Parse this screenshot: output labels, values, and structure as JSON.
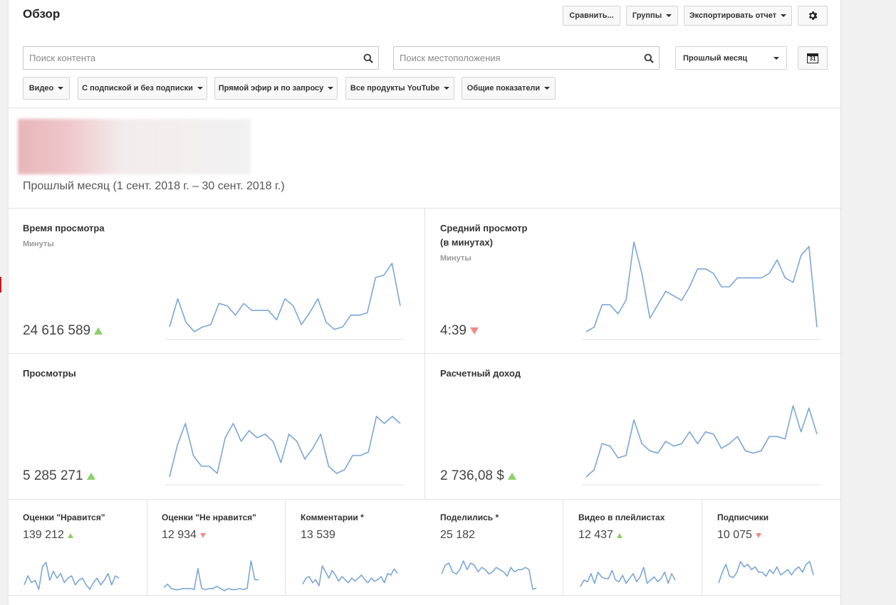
{
  "header": {
    "title": "Обзор",
    "compare_label": "Сравнить...",
    "groups_label": "Группы",
    "export_label": "Экспортировать отчет"
  },
  "search": {
    "content_placeholder": "Поиск контента",
    "location_placeholder": "Поиск местоположения"
  },
  "period": {
    "selected": "Прошлый месяц",
    "calendar_day": "31",
    "range_text": "Прошлый месяц (1 сент. 2018 г. – 30 сент. 2018 г.)"
  },
  "filters": [
    {
      "label": "Видео"
    },
    {
      "label": "С подпиской и без подписки"
    },
    {
      "label": "Прямой эфир и по запросу"
    },
    {
      "label": "Все продукты YouTube"
    },
    {
      "label": "Общие показатели"
    }
  ],
  "colors": {
    "line": "#7ba6d6",
    "up": "#8bd06a",
    "down": "#f08a85"
  },
  "metrics_big": [
    {
      "title": "Время просмотра",
      "sub": "Минуты",
      "value": "24 616 589",
      "trend": "up",
      "series": [
        12,
        24,
        14,
        10,
        12,
        13,
        22,
        21,
        17,
        22,
        19,
        19,
        19,
        15,
        24,
        21,
        13,
        18,
        24,
        14,
        11,
        12,
        17,
        17,
        18,
        33,
        34,
        39,
        21
      ]
    },
    {
      "title_line1": "Средний просмотр",
      "title_line2": "(в минутах)",
      "sub": "Минуты",
      "value": "4:39",
      "trend": "down",
      "series": [
        28,
        29,
        34,
        34,
        32,
        35,
        48,
        41,
        31,
        34,
        37,
        36,
        35,
        38,
        42,
        42,
        41,
        38,
        38,
        40,
        40,
        40,
        40,
        41,
        44,
        40,
        39,
        45,
        47,
        29
      ]
    },
    {
      "title": "Просмотры",
      "value": "5 285 271",
      "trend": "up",
      "series": [
        10,
        19,
        25,
        16,
        13,
        13,
        11,
        21,
        25,
        20,
        23,
        21,
        22,
        20,
        14,
        22,
        20,
        15,
        18,
        22,
        13,
        11,
        12,
        16,
        16,
        17,
        27,
        25,
        27,
        25
      ]
    },
    {
      "title": "Расчетный доход",
      "value": "2 736,08 $",
      "trend": "up",
      "series": [
        7,
        10,
        21,
        20,
        15,
        16,
        31,
        21,
        18,
        17,
        22,
        20,
        21,
        26,
        21,
        26,
        25,
        19,
        21,
        24,
        18,
        17,
        18,
        24,
        24,
        23,
        37,
        26,
        36,
        25
      ]
    }
  ],
  "metrics_small": [
    {
      "title": "Оценки \"Нравится\"",
      "value": "139 212",
      "trend": "up",
      "series": [
        8,
        12,
        9,
        10,
        6,
        16,
        18,
        10,
        14,
        11,
        13,
        9,
        11,
        12,
        8,
        10,
        11,
        8,
        6,
        9,
        11,
        8,
        10,
        13,
        8,
        12,
        11
      ]
    },
    {
      "title": "Оценки \"Не нравится\"",
      "value": "12 934",
      "trend": "down",
      "series": [
        3,
        6,
        2,
        1,
        1,
        2,
        2,
        2,
        1,
        20,
        2,
        1,
        2,
        2,
        4,
        2,
        0,
        2,
        1,
        1,
        2,
        1,
        2,
        27,
        10,
        10
      ]
    },
    {
      "title": "Комментарии *",
      "value": "13 539",
      "trend": "none",
      "series": [
        8,
        12,
        13,
        9,
        11,
        7,
        20,
        16,
        12,
        17,
        14,
        10,
        13,
        11,
        9,
        12,
        10,
        12,
        14,
        11,
        9,
        12,
        10,
        11,
        13,
        9,
        15,
        14,
        18,
        15
      ]
    },
    {
      "title": "Поделились *",
      "value": "25 182",
      "trend": "none",
      "series": [
        18,
        26,
        28,
        20,
        18,
        22,
        30,
        22,
        28,
        26,
        20,
        24,
        22,
        18,
        20,
        24,
        22,
        20,
        16,
        24,
        20,
        22,
        22,
        24,
        22,
        4,
        5
      ]
    },
    {
      "title": "Видео в плейлистах",
      "value": "12 437",
      "trend": "up",
      "series": [
        7,
        11,
        10,
        15,
        9,
        16,
        13,
        12,
        12,
        17,
        11,
        10,
        14,
        9,
        12,
        15,
        10,
        13,
        19,
        9,
        11,
        13,
        10,
        12,
        16,
        9,
        15,
        11
      ]
    },
    {
      "title": "Подписчики",
      "value": "10 075",
      "trend": "down",
      "series": [
        10,
        18,
        24,
        15,
        14,
        18,
        26,
        22,
        24,
        20,
        22,
        18,
        18,
        15,
        20,
        17,
        22,
        16,
        18,
        20,
        16,
        20,
        22,
        18,
        24,
        26,
        16
      ]
    }
  ]
}
